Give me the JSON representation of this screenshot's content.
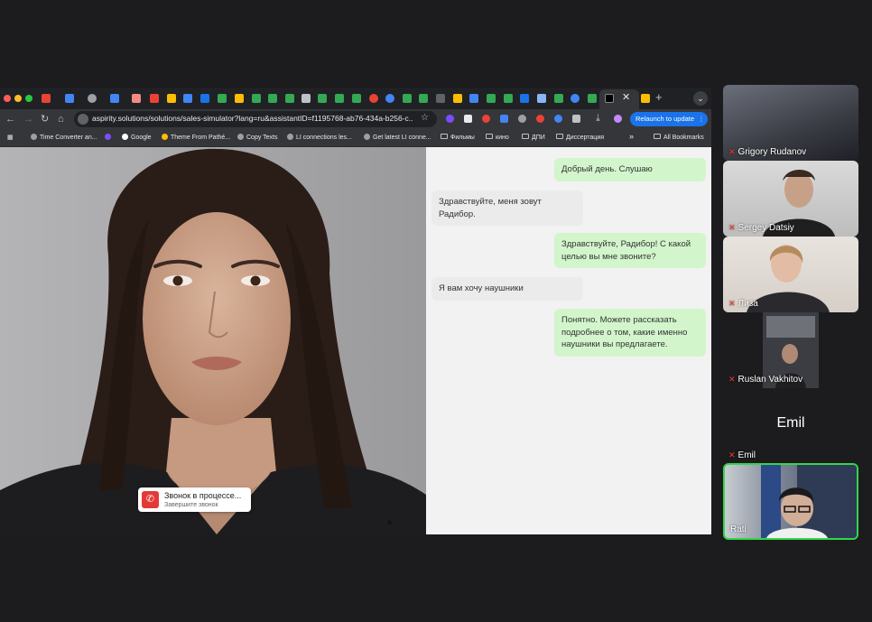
{
  "browser": {
    "url": "aspirity.solutions/solutions/sales-simulator?lang=ru&assistantID=f1195768-ab76-434a-b256-c...",
    "relaunch_label": "Relaunch to update",
    "bookmarks": [
      "Time Converter an...",
      "Google",
      "Theme From Pathé...",
      "Copy Texts",
      "LI connections les...",
      "Get latest LI conne...",
      "Фильмы",
      "кино",
      "ДПИ",
      "Диссертация"
    ],
    "all_bookmarks_label": "All Bookmarks"
  },
  "call": {
    "title": "Звонок в процессе...",
    "subtitle": "Завершите звонок"
  },
  "chat": {
    "messages": [
      {
        "from": "user",
        "text": "Добрый день. Слушаю"
      },
      {
        "from": "assistant",
        "text": "Здравствуйте, меня зовут Радибор."
      },
      {
        "from": "user",
        "text": "Здравствуйте, Радибор! С какой целью вы мне звоните?"
      },
      {
        "from": "assistant",
        "text": "Я вам хочу наушники"
      },
      {
        "from": "user",
        "text": "Понятно. Можете рассказать подробнее о том, какие именно наушники вы предлагаете."
      }
    ]
  },
  "participants": [
    {
      "name": "Grigory Rudanov",
      "muted": true
    },
    {
      "name": "Sergey Datsiy",
      "muted": true
    },
    {
      "name": "Лиза",
      "muted": true
    },
    {
      "name": "Ruslan Vakhitov",
      "muted": true
    },
    {
      "name": "Emil",
      "muted": true,
      "video_off": true
    },
    {
      "name": "Rati",
      "muted": false,
      "active_speaker": true
    }
  ],
  "colors": {
    "user_bubble": "#d2f5cb",
    "assistant_bubble": "#ebebeb",
    "accent_blue": "#1a73e8",
    "call_red": "#e53935",
    "active_speaker": "#32d74b"
  }
}
